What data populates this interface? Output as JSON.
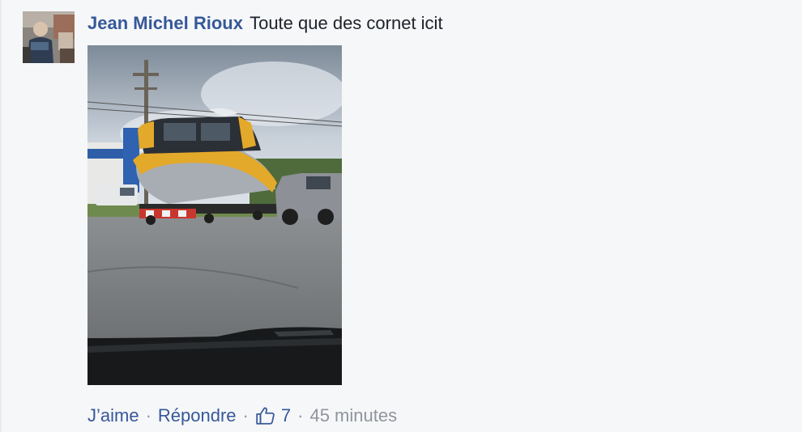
{
  "comment": {
    "author": "Jean Michel Rioux",
    "text": "Toute que des cornet icit",
    "avatar_icon": "user-photo",
    "photo_icon": "boat-on-truck-photo",
    "actions": {
      "like_label": "J’aime",
      "separator": "·",
      "reply_label": "Répondre",
      "like_icon": "thumbs-up-icon",
      "like_count": "7",
      "timestamp": "45 minutes"
    }
  },
  "colors": {
    "link": "#365899",
    "text": "#1d2129",
    "muted": "#90949c",
    "background": "#f6f7f9"
  }
}
